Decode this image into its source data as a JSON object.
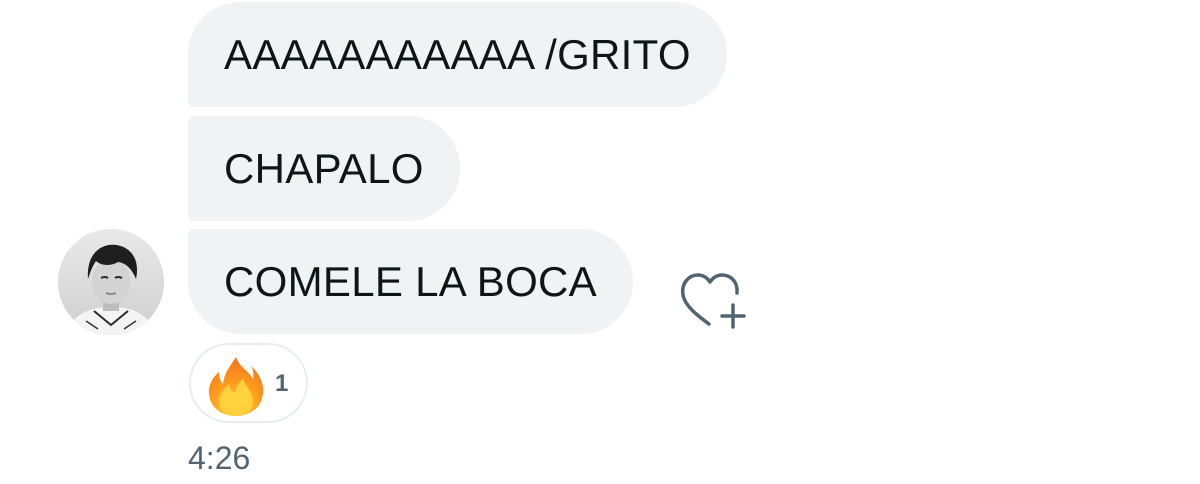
{
  "messages": [
    {
      "text": "AAAAAAAAAAA /GRITO"
    },
    {
      "text": "CHAPALO"
    },
    {
      "text": "COMELE LA BOCA"
    }
  ],
  "sender": {
    "avatar_icon": "user-avatar-photo"
  },
  "reaction": {
    "emoji_icon": "fire-emoji",
    "count": "1"
  },
  "timestamp": "4:26",
  "actions": {
    "add_reaction_icon": "heart-plus-icon"
  },
  "colors": {
    "bubble": "#eff3f4",
    "text": "#0f1419",
    "secondary_text": "#536471",
    "pill_border": "#e6ecf0"
  }
}
